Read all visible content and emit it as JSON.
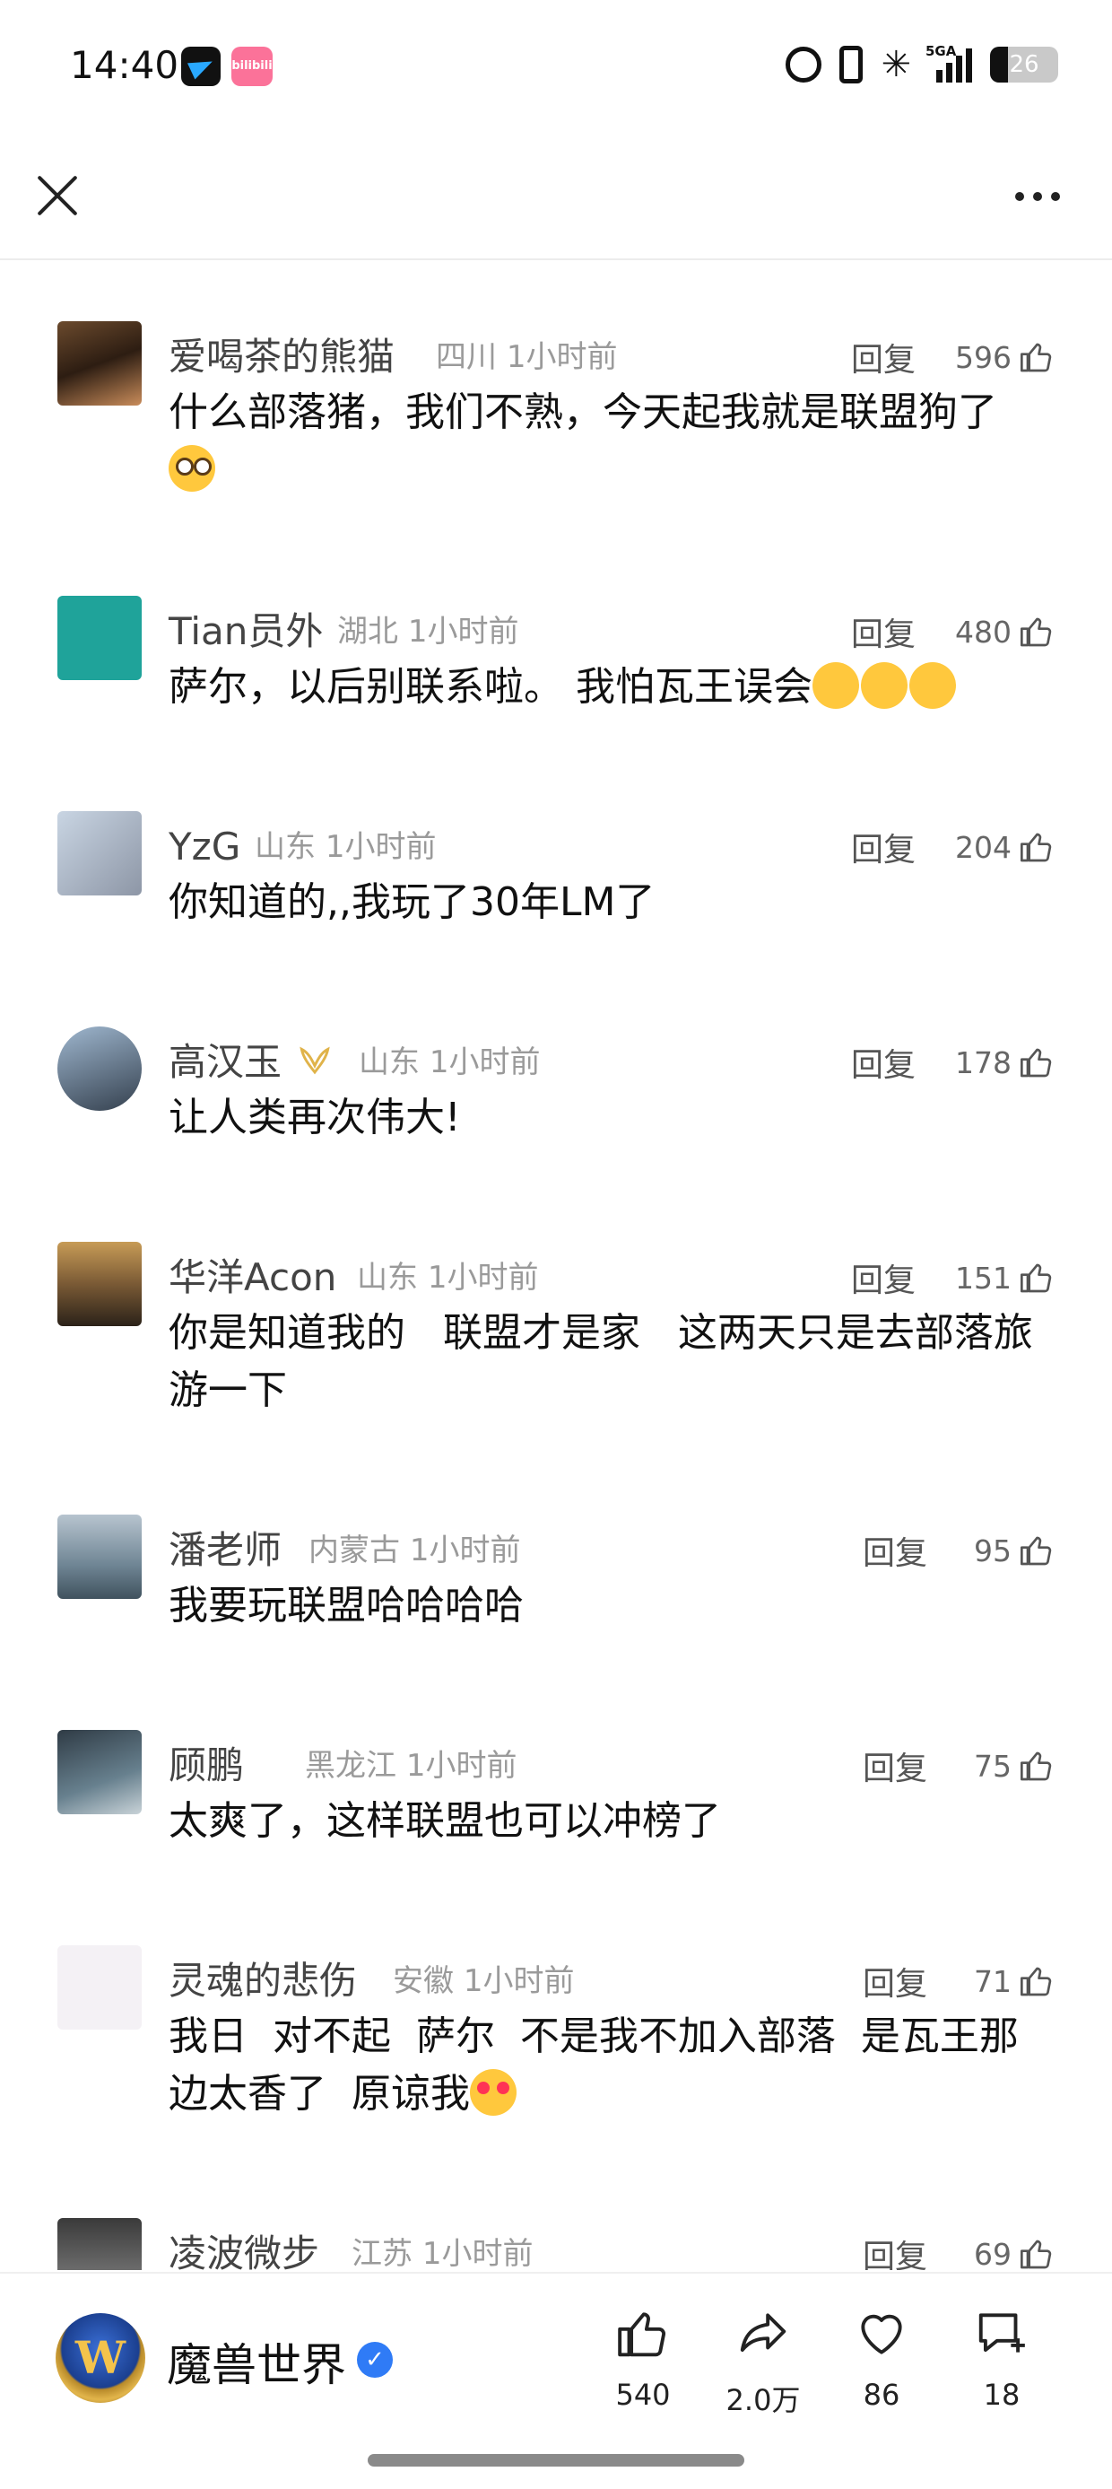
{
  "status_bar": {
    "time": "14:40",
    "app2_label": "bilibili",
    "network": "5GA",
    "battery_level": "26",
    "icons": [
      "alarm-icon",
      "vibrate-icon",
      "bluetooth-icon",
      "signal-icon",
      "battery-icon"
    ]
  },
  "header": {
    "close_icon": "close-icon",
    "more_icon": "more-icon"
  },
  "comments": [
    {
      "name": "爱喝茶的熊猫",
      "location": "四川",
      "time": "1小时前",
      "reply": "回复",
      "likes": "596",
      "text": "什么部落猪，我们不熟，今天起我就是联盟狗了",
      "emoji": "pleading-face"
    },
    {
      "name": "Tian员外",
      "location": "湖北",
      "time": "1小时前",
      "reply": "回复",
      "likes": "480",
      "text": "萨尔，以后别联系啦。 我怕瓦王误会",
      "emoji": "loudly-crying-face"
    },
    {
      "name": "YzG",
      "location": "山东",
      "time": "1小时前",
      "reply": "回复",
      "likes": "204",
      "text": "你知道的,,我玩了30年LM了"
    },
    {
      "name": "高汉玉",
      "location": "山东",
      "time": "1小时前",
      "reply": "回复",
      "likes": "178",
      "text": "让人类再次伟大!",
      "badge": "vip-ribbon-icon"
    },
    {
      "name": "华洋Acon",
      "location": "山东",
      "time": "1小时前",
      "reply": "回复",
      "likes": "151",
      "text": "你是知道我的   联盟才是家   这两天只是去部落旅游一下"
    },
    {
      "name": "潘老师",
      "location": "内蒙古",
      "time": "1小时前",
      "reply": "回复",
      "likes": "95",
      "text": "我要玩联盟哈哈哈哈"
    },
    {
      "name": "顾鹏",
      "location": "黑龙江",
      "time": "1小时前",
      "reply": "回复",
      "likes": "75",
      "text": "太爽了，这样联盟也可以冲榜了"
    },
    {
      "name": "灵魂的悲伤",
      "location": "安徽",
      "time": "1小时前",
      "reply": "回复",
      "likes": "71",
      "text": "我日  对不起  萨尔  不是我不加入部落  是瓦王那边太香了  原谅我",
      "emoji": "heart-eyes-face"
    },
    {
      "name": "凌波微步",
      "location": "江苏",
      "time": "1小时前",
      "reply": "回复",
      "likes": "69",
      "text": ""
    }
  ],
  "bottom_bar": {
    "channel_name": "魔兽世界",
    "logo_icon": "world-of-warcraft-logo-icon",
    "verified_icon": "verified-badge-icon",
    "likes": "540",
    "shares": "2.0万",
    "favorites": "86",
    "comments": "18"
  },
  "colors": {
    "text_primary": "#111111",
    "text_name": "#444444",
    "text_meta": "#9a9a9a",
    "verified_blue": "#2f7bf6",
    "divider": "#ececec"
  }
}
